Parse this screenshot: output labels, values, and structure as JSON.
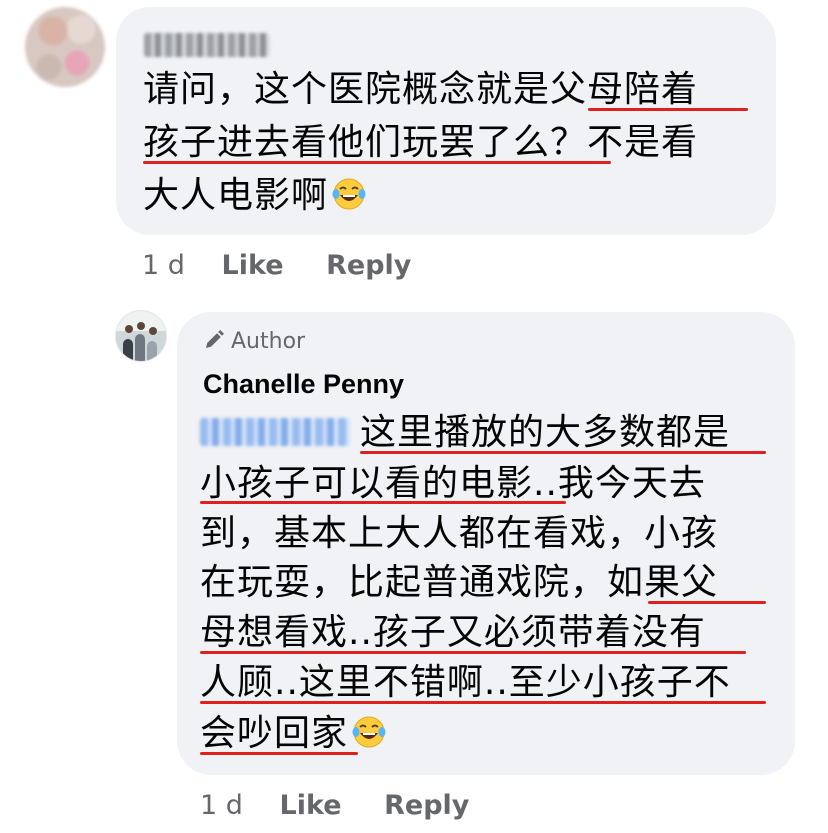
{
  "comment1": {
    "lines": [
      "请问，这个医院概念就是父母陪着",
      "孩子进去看他们玩罢了么？不是看",
      "大人电影啊"
    ],
    "emoji": "face-with-tears-of-joy",
    "time": "1 d",
    "like": "Like",
    "reply": "Reply"
  },
  "comment2": {
    "badge": "Author",
    "author": "Chanelle Penny",
    "lines": [
      "这里播放的大多数都是",
      "小孩子可以看的电影..我今天去",
      "到，基本上大人都在看戏，小孩",
      "在玩耍，比起普通戏院，如果父",
      "母想看戏..孩子又必须带着没有",
      "人顾..这里不错啊..至少小孩子不",
      "会吵回家"
    ],
    "emoji": "face-with-tears-of-joy",
    "time": "1 d",
    "like": "Like",
    "reply": "Reply"
  },
  "colors": {
    "bubble": "#f0f2f5",
    "meta": "#65676b",
    "underline": "#e0201f",
    "text": "#050505"
  }
}
